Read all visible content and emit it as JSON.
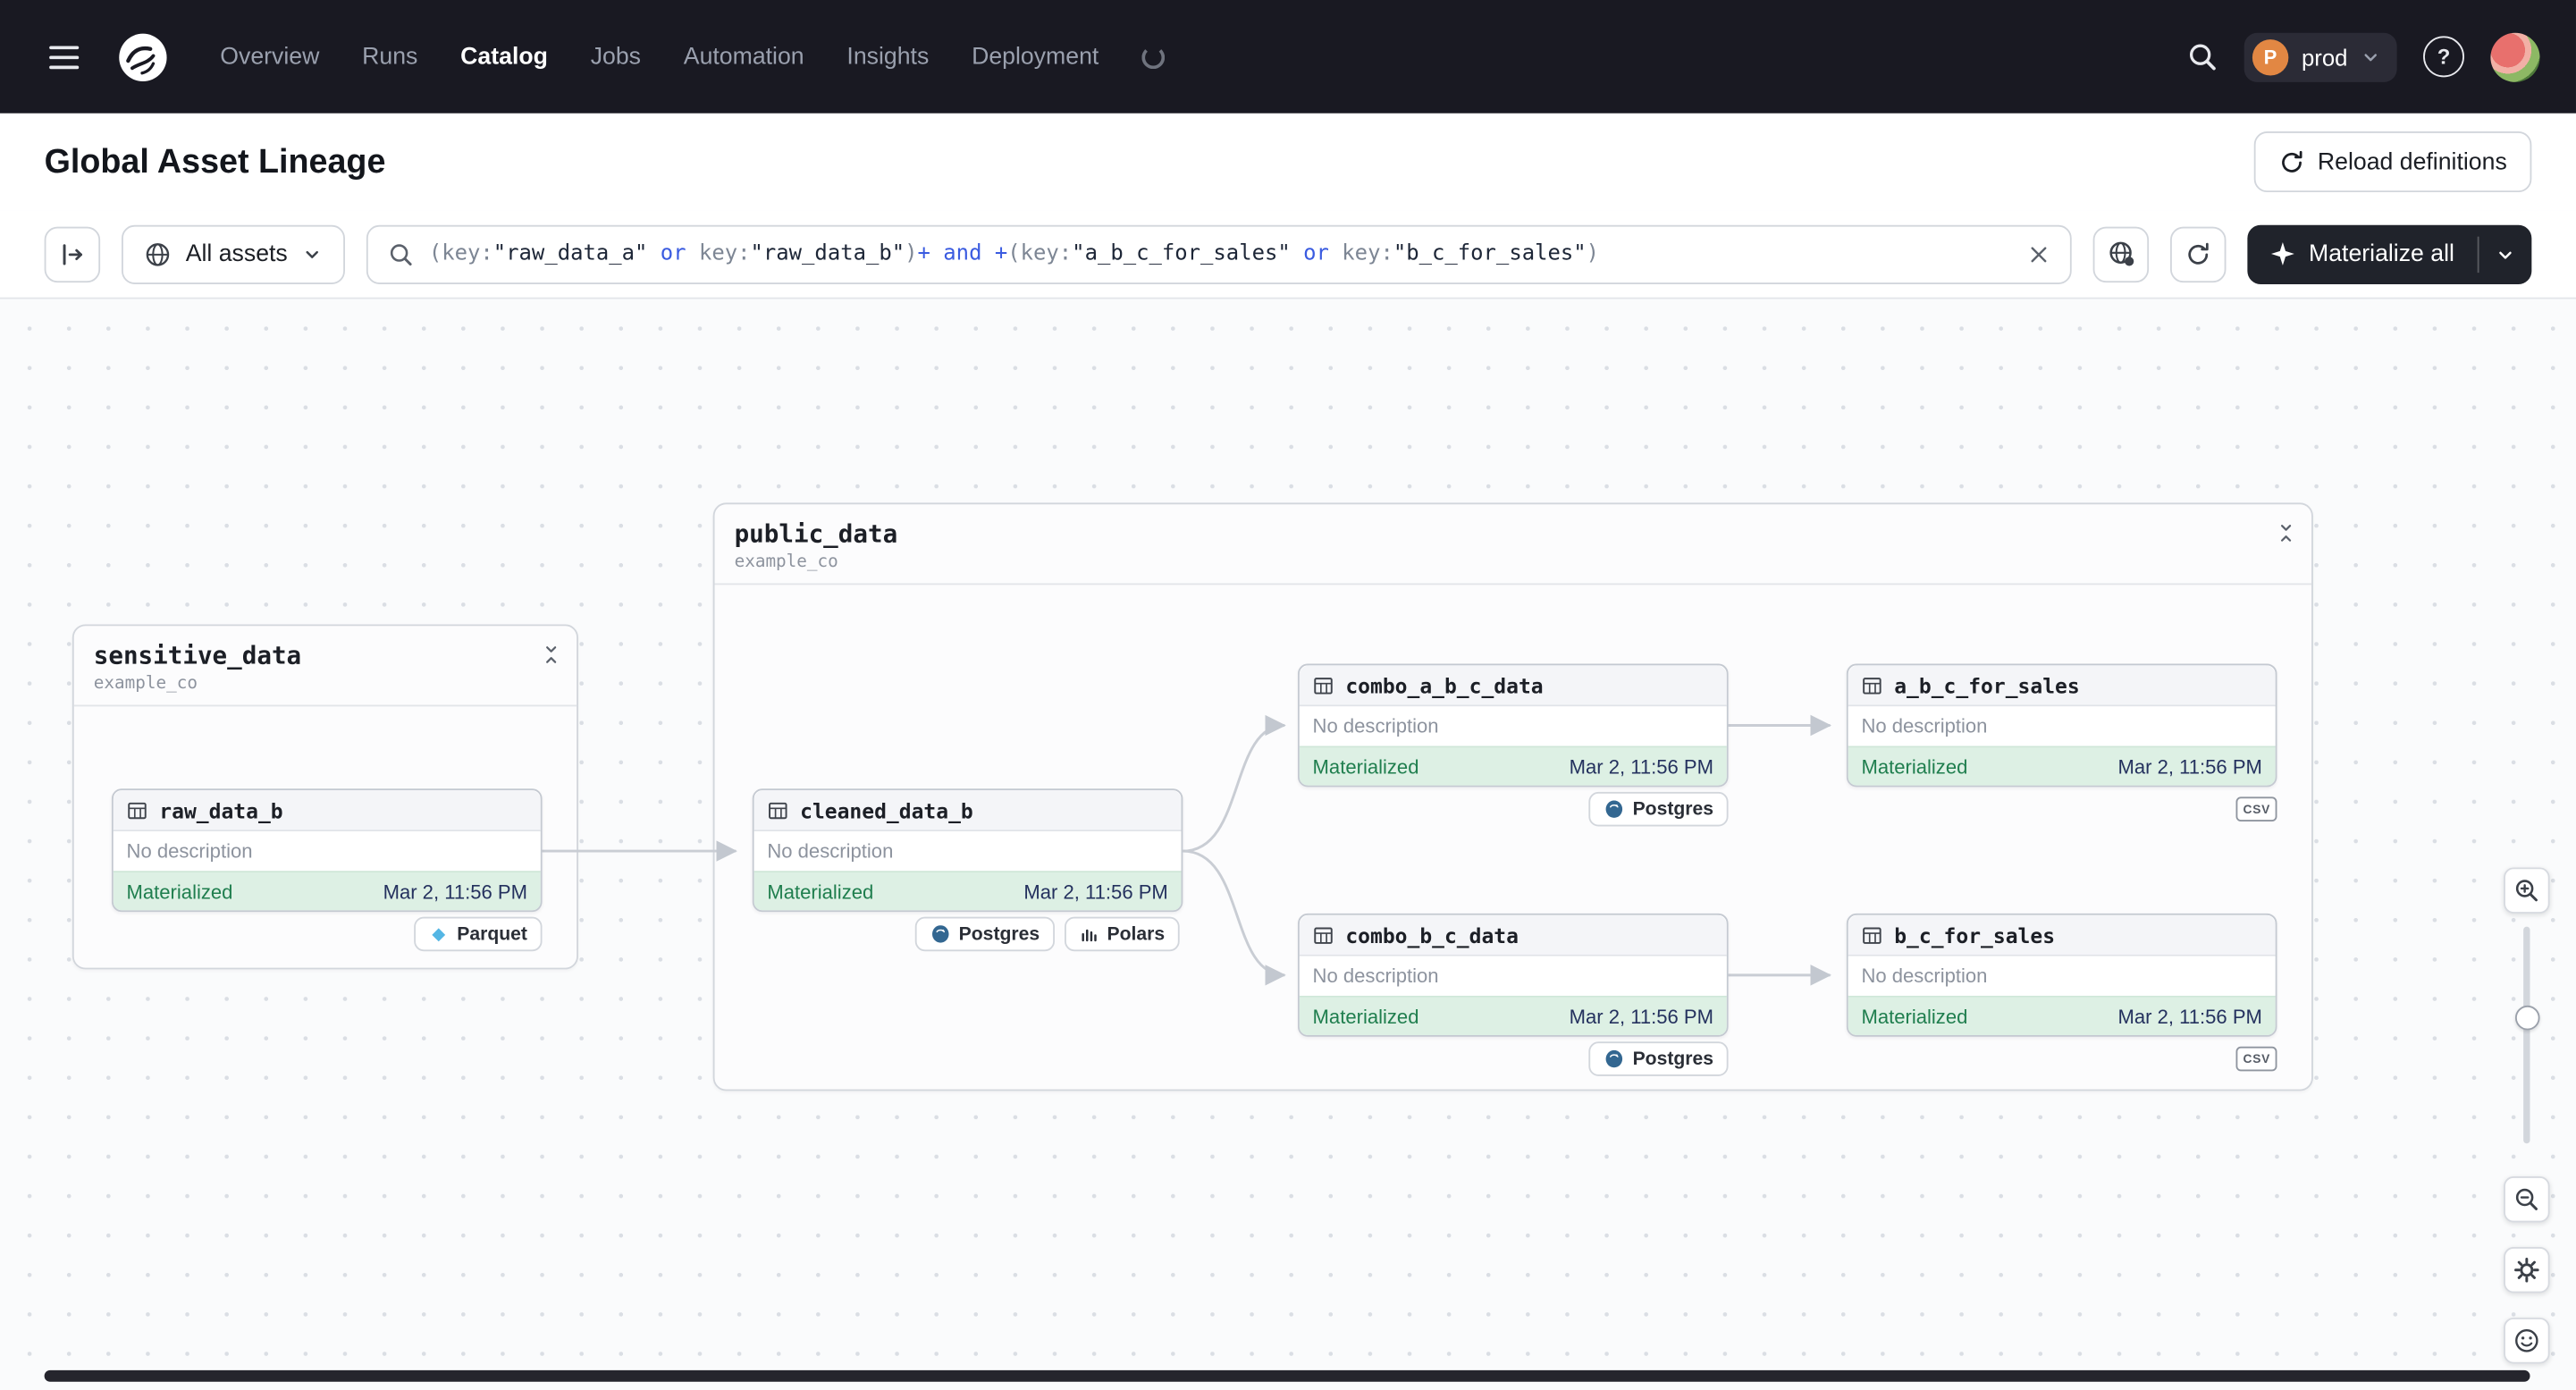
{
  "navbar": {
    "items": [
      {
        "label": "Overview"
      },
      {
        "label": "Runs"
      },
      {
        "label": "Catalog"
      },
      {
        "label": "Jobs"
      },
      {
        "label": "Automation"
      },
      {
        "label": "Insights"
      },
      {
        "label": "Deployment"
      }
    ],
    "active_item": "Catalog",
    "env": {
      "initial": "P",
      "label": "prod"
    }
  },
  "header": {
    "title": "Global Asset Lineage",
    "reload_button": "Reload definitions"
  },
  "toolbar": {
    "scope": "All assets",
    "materialize": "Materialize all",
    "query_segments": [
      {
        "text": "(key:",
        "kind": "p"
      },
      {
        "text": "\"raw_data_a\"",
        "kind": "s"
      },
      {
        "text": " or ",
        "kind": "o"
      },
      {
        "text": "key:",
        "kind": "p"
      },
      {
        "text": "\"raw_data_b\"",
        "kind": "s"
      },
      {
        "text": ")",
        "kind": "p"
      },
      {
        "text": "+",
        "kind": "o"
      },
      {
        "text": " and ",
        "kind": "o"
      },
      {
        "text": "+",
        "kind": "o"
      },
      {
        "text": "(key:",
        "kind": "p"
      },
      {
        "text": "\"a_b_c_for_sales\"",
        "kind": "s"
      },
      {
        "text": " or ",
        "kind": "o"
      },
      {
        "text": "key:",
        "kind": "p"
      },
      {
        "text": "\"b_c_for_sales\"",
        "kind": "s"
      },
      {
        "text": ")",
        "kind": "p"
      }
    ]
  },
  "groups": {
    "sensitive_data": {
      "name": "sensitive_data",
      "location": "example_co"
    },
    "public_data": {
      "name": "public_data",
      "location": "example_co"
    }
  },
  "nodes": {
    "raw_data_b": {
      "name": "raw_data_b",
      "description": "No description",
      "status": "Materialized",
      "timestamp": "Mar 2, 11:56 PM"
    },
    "cleaned_data_b": {
      "name": "cleaned_data_b",
      "description": "No description",
      "status": "Materialized",
      "timestamp": "Mar 2, 11:56 PM"
    },
    "combo_a_b_c_data": {
      "name": "combo_a_b_c_data",
      "description": "No description",
      "status": "Materialized",
      "timestamp": "Mar 2, 11:56 PM"
    },
    "a_b_c_for_sales": {
      "name": "a_b_c_for_sales",
      "description": "No description",
      "status": "Materialized",
      "timestamp": "Mar 2, 11:56 PM"
    },
    "combo_b_c_data": {
      "name": "combo_b_c_data",
      "description": "No description",
      "status": "Materialized",
      "timestamp": "Mar 2, 11:56 PM"
    },
    "b_c_for_sales": {
      "name": "b_c_for_sales",
      "description": "No description",
      "status": "Materialized",
      "timestamp": "Mar 2, 11:56 PM"
    }
  },
  "tags": {
    "parquet": "Parquet",
    "postgres": "Postgres",
    "polars": "Polars",
    "csv": "CSV"
  },
  "colors": {
    "navbar_bg": "#191922",
    "materialized_bg": "#ddf0e4",
    "materialized_text": "#1f7e4e",
    "timestamp_text": "#24315e",
    "operator_blue": "#3a5be0",
    "edge_gray": "#c9cdd4",
    "postgres_blue": "#336791",
    "parquet_blue": "#54b6e4"
  }
}
